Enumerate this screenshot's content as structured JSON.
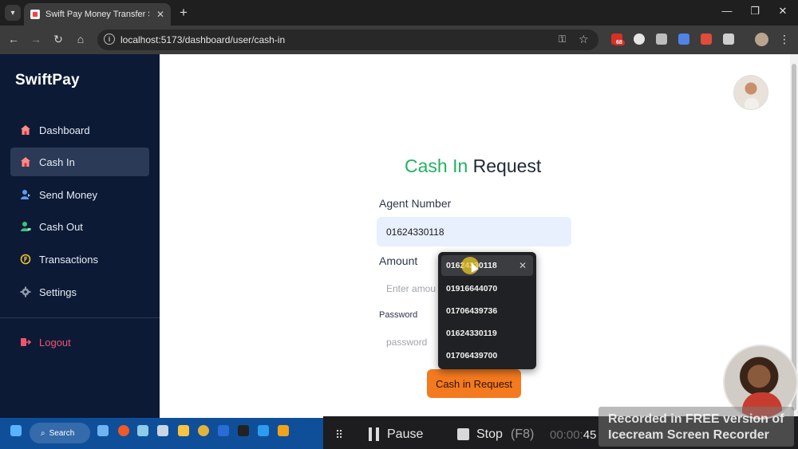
{
  "browser": {
    "tab_title": "Swift Pay Money Transfer Servic",
    "url": "localhost:5173/dashboard/user/cash-in",
    "extension_badge": "68"
  },
  "sidebar": {
    "brand": "SwiftPay",
    "items": [
      {
        "label": "Dashboard",
        "icon": "house-icon"
      },
      {
        "label": "Cash In",
        "icon": "house-icon",
        "active": true
      },
      {
        "label": "Send Money",
        "icon": "user-send-icon"
      },
      {
        "label": "Cash Out",
        "icon": "user-cashout-icon"
      },
      {
        "label": "Transactions",
        "icon": "currency-circle-icon"
      },
      {
        "label": "Settings",
        "icon": "gear-icon"
      }
    ],
    "logout": "Logout"
  },
  "form": {
    "title_accent": "Cash In",
    "title_rest": " Request",
    "agent_label": "Agent Number",
    "agent_value": "01624330118",
    "amount_label": "Amount",
    "amount_placeholder": "Enter amou",
    "password_label": "Password",
    "password_placeholder": "password",
    "submit": "Cash in Request"
  },
  "autofill": {
    "options": [
      "01624330118",
      "01916644070",
      "01706439736",
      "01624330119",
      "01706439700"
    ]
  },
  "taskbar": {
    "search": "Search"
  },
  "recorder": {
    "pause": "Pause",
    "stop": "Stop",
    "stop_key": "(F8)",
    "time_dim": "00:00:",
    "time_bright": "45",
    "watermark_line1": "Recorded in FREE version of",
    "watermark_line2": "Icecream Screen Recorder"
  },
  "colors": {
    "sidebar_bg": "#0c1a36",
    "accent_green": "#22b35e",
    "button_orange": "#f47a1f",
    "logout_red": "#f0536b"
  }
}
